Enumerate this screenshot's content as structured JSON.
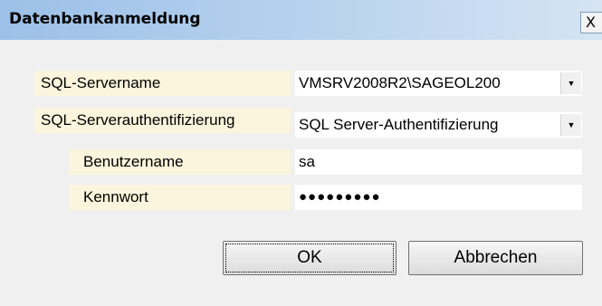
{
  "window": {
    "title": "Datenbankanmeldung",
    "close_label": "X"
  },
  "form": {
    "server_label": "SQL-Servername",
    "server_value": "VMSRV2008R2\\SAGEOL200",
    "auth_label": "SQL-Serverauthentifizierung",
    "auth_value": "SQL Server-Authentifizierung",
    "user_label": "Benutzername",
    "user_value": "sa",
    "password_label": "Kennwort",
    "password_mask": "●●●●●●●●●"
  },
  "buttons": {
    "ok": "OK",
    "cancel": "Abbrechen"
  },
  "icons": {
    "dropdown": "chevron-down-icon"
  }
}
